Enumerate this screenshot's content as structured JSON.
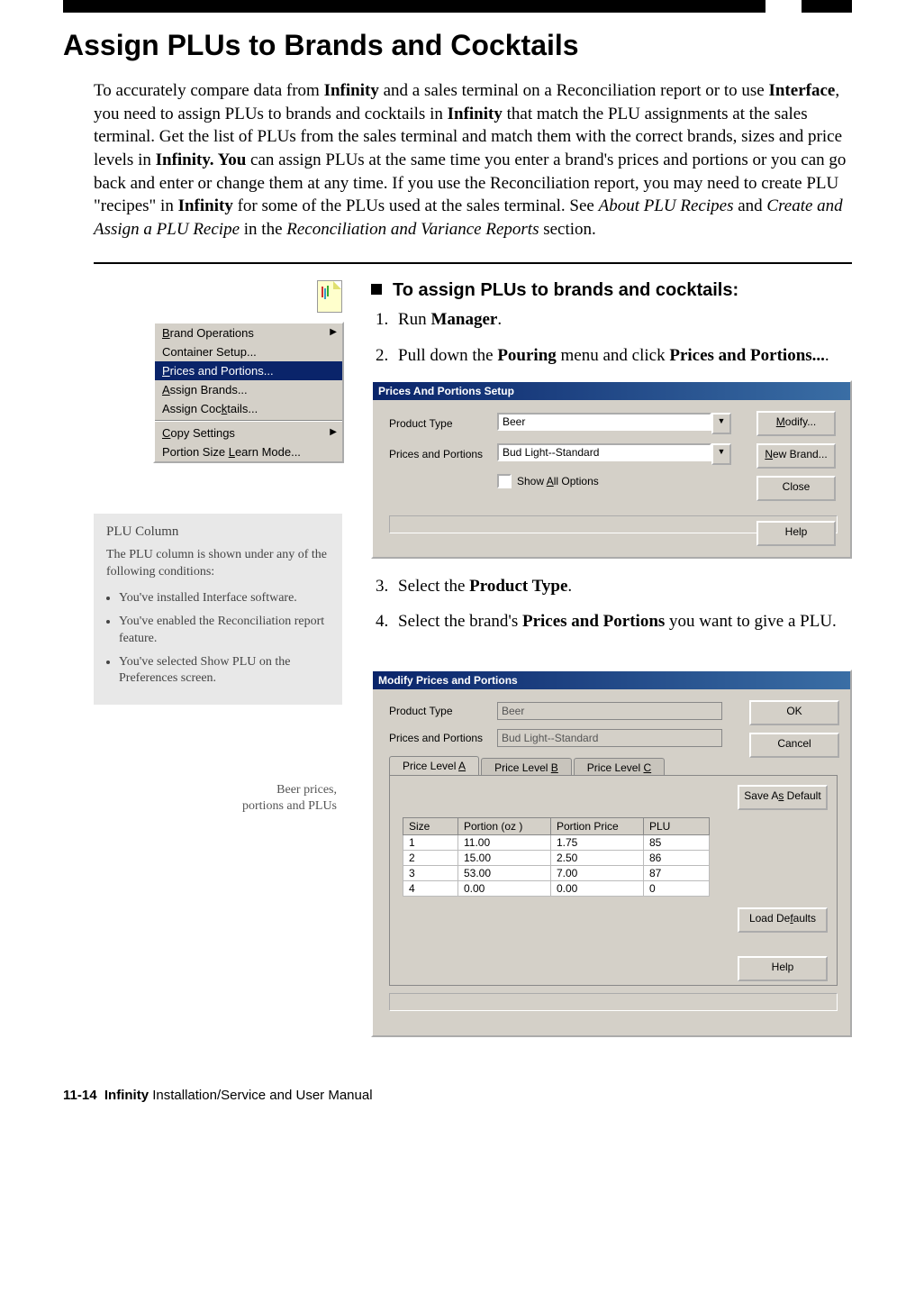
{
  "page_title": "Assign PLUs to Brands and Cocktails",
  "intro": {
    "t1": "To accurately compare data from ",
    "b1": "Infinity",
    "t2": " and a sales terminal on a Reconciliation report or to use ",
    "b2": "Interface",
    "t3": ", you need to assign PLUs to brands and cocktails in ",
    "b3": "Infinity",
    "t4": " that match the PLU assignments at the sales terminal. Get the list of PLUs from the sales terminal and match them with the correct brands, sizes and price levels in ",
    "b4": "Infinity. You",
    "t5": " can assign PLUs at the same time you enter a brand's prices and portions or you can go back and enter or change them at any time. If you use the Reconciliation report, you may need to create PLU \"recipes\" in ",
    "b5": "Infinity",
    "t6": " for some of the PLUs used at the sales terminal. See ",
    "i1": "About PLU Recipes",
    "t7": " and ",
    "i2": "Create and Assign a PLU Recipe",
    "t8": " in the ",
    "i3": "Reconciliation and Variance Reports",
    "t9": " section."
  },
  "proc_head": "To assign PLUs to brands and cocktails:",
  "steps": {
    "s1a": "Run ",
    "s1b": "Manager",
    "s1c": ".",
    "s2a": "Pull down the ",
    "s2b": "Pouring",
    "s2c": " menu and click ",
    "s2d": "Prices and Portions...",
    "s2e": ".",
    "s3a": "Select the ",
    "s3b": "Product Type",
    "s3c": ".",
    "s4a": "Select the brand's ",
    "s4b": "Prices and Portions",
    "s4c": " you want to give a PLU."
  },
  "menu_items": {
    "m0": "Brand Operations",
    "m1": "Container Setup...",
    "m2": "Prices and Portions...",
    "m3": "Assign Brands...",
    "m4": "Assign Cocktails...",
    "m5": "Copy Settings",
    "m6": "Portion Size Learn Mode..."
  },
  "sidebar": {
    "title": "PLU Column",
    "text": "The PLU column is shown under any of the following conditions:",
    "li1": "You've installed Interface software.",
    "li2": "You've enabled the Reconciliation report feature.",
    "li3": "You've selected Show PLU on the Preferences screen."
  },
  "caption": "Beer prices,\nportions and PLUs",
  "dlg1": {
    "title": "Prices And Portions Setup",
    "label_pt": "Product Type",
    "label_pp": "Prices and Portions",
    "val_pt": "Beer",
    "val_pp": "Bud Light--Standard",
    "chk": "Show All Options",
    "btn_modify": "Modify...",
    "btn_new": "New Brand...",
    "btn_close": "Close",
    "btn_help": "Help"
  },
  "dlg2": {
    "title": "Modify Prices and Portions",
    "label_pt": "Product Type",
    "label_pp": "Prices and Portions",
    "val_pt": "Beer",
    "val_pp": "Bud Light--Standard",
    "tabA": "Price Level A",
    "tabB": "Price Level B",
    "tabC": "Price Level C",
    "col_size": "Size",
    "col_portion": "Portion (oz  )",
    "col_price": "Portion Price",
    "col_plu": "PLU",
    "rows": [
      {
        "size": "1",
        "portion": "11.00",
        "price": "1.75",
        "plu": "85"
      },
      {
        "size": "2",
        "portion": "15.00",
        "price": "2.50",
        "plu": "86"
      },
      {
        "size": "3",
        "portion": "53.00",
        "price": "7.00",
        "plu": "87"
      },
      {
        "size": "4",
        "portion": "0.00",
        "price": "0.00",
        "plu": "0"
      }
    ],
    "btn_ok": "OK",
    "btn_cancel": "Cancel",
    "btn_savedef": "Save As Default",
    "btn_loaddef": "Load Defaults",
    "btn_help": "Help"
  },
  "footer": {
    "pageno": "11-14",
    "bold": "Infinity",
    "rest": " Installation/Service and User Manual"
  }
}
